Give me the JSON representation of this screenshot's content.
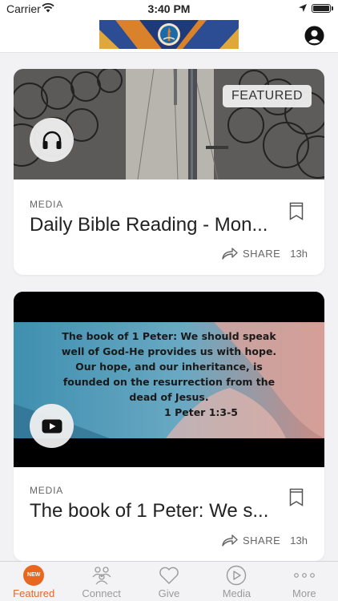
{
  "status_bar": {
    "carrier": "Carrier",
    "time": "3:40 PM"
  },
  "nav": {
    "logo_icon": "church-logo",
    "profile_icon": "person-icon"
  },
  "cards": [
    {
      "badge": "FEATURED",
      "category": "MEDIA",
      "title": "Daily Bible Reading - Mon...",
      "share_label": "SHARE",
      "time_ago": "13h",
      "media_icon": "headphones-icon"
    },
    {
      "category": "MEDIA",
      "title": "The book of 1 Peter: We s...",
      "share_label": "SHARE",
      "time_ago": "13h",
      "media_icon": "youtube-play-icon",
      "video_lines": [
        "The book of 1 Peter:  We should speak",
        "well of God-He provides us with hope.",
        "Our hope, and our inheritance, is",
        "founded on the resurrection from the",
        "dead of Jesus.",
        "1 Peter 1:3-5"
      ]
    }
  ],
  "tabs": [
    {
      "label": "Featured",
      "badge": "NEW",
      "active": true
    },
    {
      "label": "Connect",
      "icon": "people-icon"
    },
    {
      "label": "Give",
      "icon": "heart-icon"
    },
    {
      "label": "Media",
      "icon": "play-circle-icon"
    },
    {
      "label": "More",
      "icon": "more-dots-icon"
    }
  ],
  "colors": {
    "accent": "#e8661f",
    "background": "#f2f2f4",
    "inactive": "#9a9a9a"
  }
}
